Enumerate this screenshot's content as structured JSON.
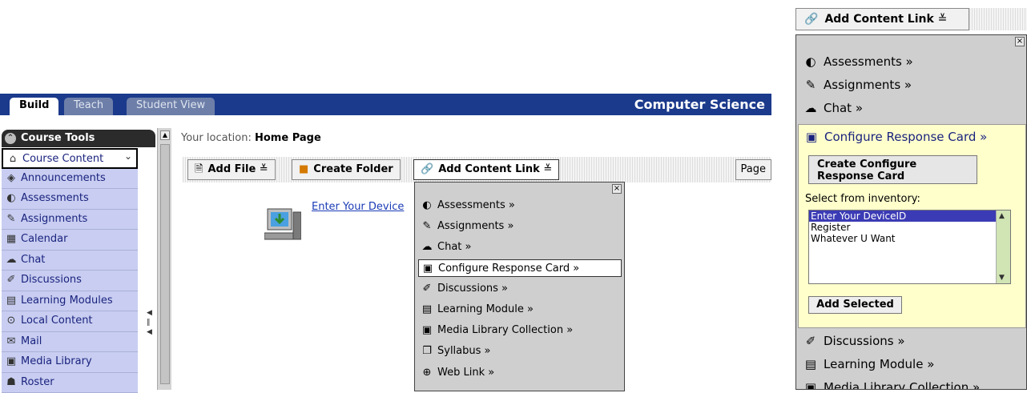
{
  "tabs": [
    {
      "label": "Build",
      "active": true
    },
    {
      "label": "Teach",
      "active": false
    },
    {
      "label": "Student View",
      "active": false
    }
  ],
  "course_title": "Computer Science",
  "sidebar": {
    "header": "Course Tools",
    "items": [
      {
        "label": "Course Content",
        "icon": "course-content-icon",
        "glyph": "⌂"
      },
      {
        "label": "Announcements",
        "icon": "announcements-icon",
        "glyph": "◈"
      },
      {
        "label": "Assessments",
        "icon": "assessments-icon",
        "glyph": "◐"
      },
      {
        "label": "Assignments",
        "icon": "assignments-icon",
        "glyph": "✎"
      },
      {
        "label": "Calendar",
        "icon": "calendar-icon",
        "glyph": "▦"
      },
      {
        "label": "Chat",
        "icon": "chat-icon",
        "glyph": "☁"
      },
      {
        "label": "Discussions",
        "icon": "discussions-icon",
        "glyph": "✐"
      },
      {
        "label": "Learning Modules",
        "icon": "learning-modules-icon",
        "glyph": "▤"
      },
      {
        "label": "Local Content",
        "icon": "local-content-icon",
        "glyph": "⊙"
      },
      {
        "label": "Mail",
        "icon": "mail-icon",
        "glyph": "✉"
      },
      {
        "label": "Media Library",
        "icon": "media-library-icon",
        "glyph": "▣"
      },
      {
        "label": "Roster",
        "icon": "roster-icon",
        "glyph": "☗"
      }
    ]
  },
  "location": {
    "prefix": "Your location:",
    "page": "Home Page"
  },
  "toolbar": {
    "add_file": "Add File",
    "create_folder": "Create Folder",
    "add_content_link": "Add Content Link",
    "page": "Page"
  },
  "content": {
    "device_link": "Enter Your Device"
  },
  "dropdown": {
    "items": [
      {
        "label": "Assessments »",
        "icon": "assessments-icon",
        "glyph": "◐"
      },
      {
        "label": "Assignments »",
        "icon": "assignments-icon",
        "glyph": "✎"
      },
      {
        "label": "Chat »",
        "icon": "chat-icon",
        "glyph": "☁"
      },
      {
        "label": "Configure Response Card »",
        "icon": "response-card-icon",
        "glyph": "▣"
      },
      {
        "label": "Discussions »",
        "icon": "discussions-icon",
        "glyph": "✐"
      },
      {
        "label": "Learning Module »",
        "icon": "learning-module-icon",
        "glyph": "▤"
      },
      {
        "label": "Media Library Collection »",
        "icon": "media-library-icon",
        "glyph": "▣"
      },
      {
        "label": "Syllabus »",
        "icon": "syllabus-icon",
        "glyph": "❐"
      },
      {
        "label": "Web Link »",
        "icon": "web-link-icon",
        "glyph": "⊕"
      }
    ],
    "selected_index": 3
  },
  "zoom": {
    "button": "Add Content Link",
    "items_above": [
      {
        "label": "Assessments »",
        "icon": "assessments-icon",
        "glyph": "◐"
      },
      {
        "label": "Assignments »",
        "icon": "assignments-icon",
        "glyph": "✎"
      },
      {
        "label": "Chat »",
        "icon": "chat-icon",
        "glyph": "☁"
      }
    ],
    "selected_label": "Configure Response Card »",
    "create_button": "Create Configure Response Card",
    "inventory_label": "Select from inventory:",
    "inventory": [
      "Enter Your DeviceID",
      "Register",
      "Whatever U Want"
    ],
    "inventory_selected": "Enter Your DeviceID",
    "add_selected": "Add Selected",
    "items_below": [
      {
        "label": "Discussions »",
        "icon": "discussions-icon",
        "glyph": "✐"
      },
      {
        "label": "Learning Module »",
        "icon": "learning-module-icon",
        "glyph": "▤"
      },
      {
        "label": "Media Library Collection »",
        "icon": "media-library-icon",
        "glyph": "▣"
      }
    ]
  }
}
